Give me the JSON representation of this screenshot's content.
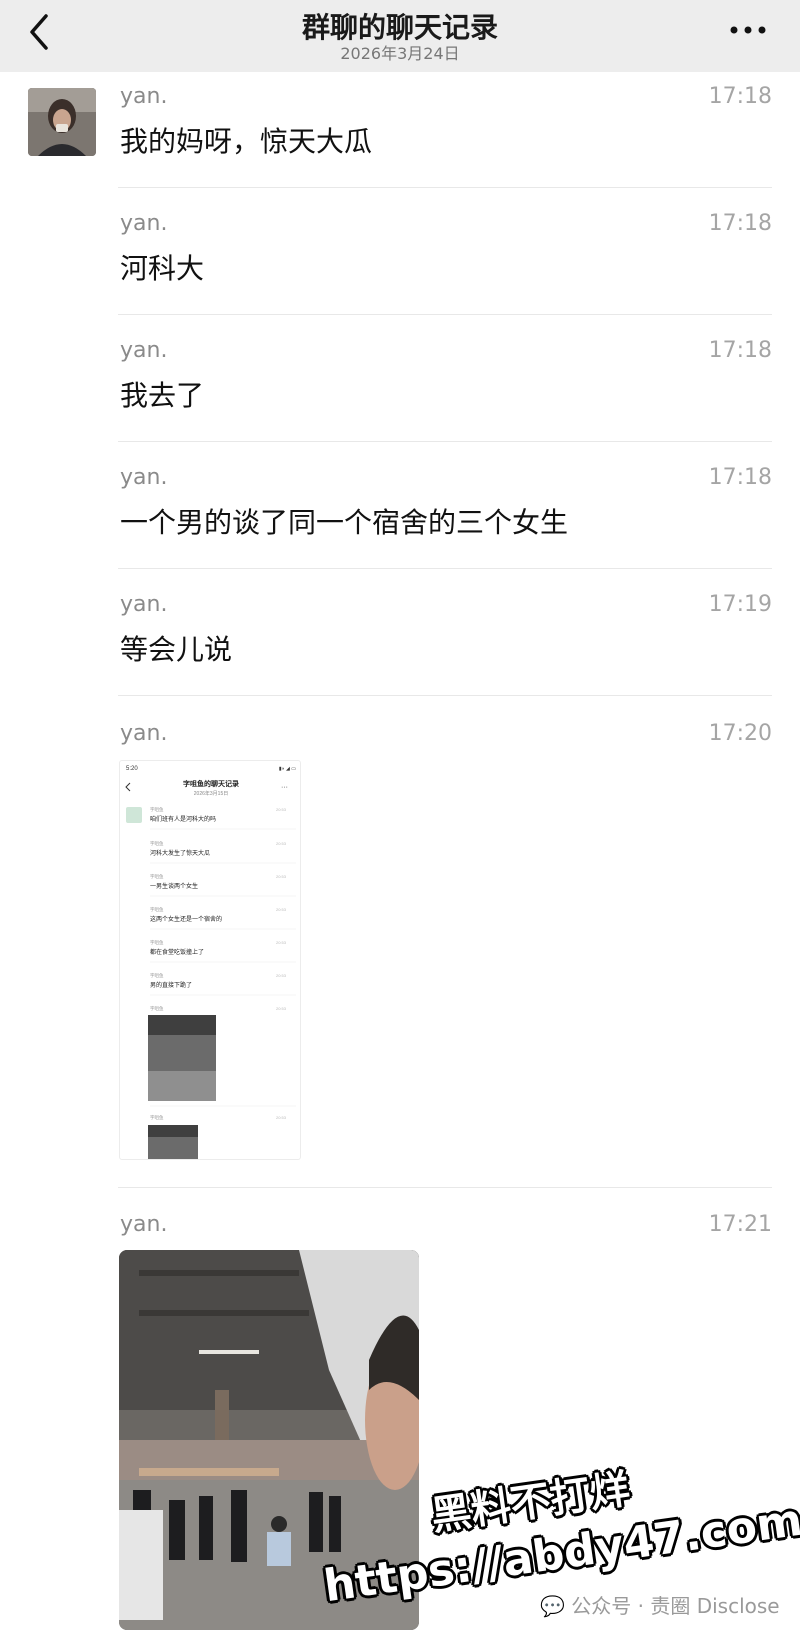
{
  "header": {
    "title": "群聊的聊天记录",
    "subtitle": "2026年3月24日",
    "back_icon": "chevron-left-icon",
    "more_icon": "more-dots-icon"
  },
  "messages": [
    {
      "sender": "yan.",
      "time": "17:18",
      "text": "我的妈呀，惊天大瓜"
    },
    {
      "sender": "yan.",
      "time": "17:18",
      "text": "河科大"
    },
    {
      "sender": "yan.",
      "time": "17:18",
      "text": "我去了"
    },
    {
      "sender": "yan.",
      "time": "17:18",
      "text": "一个男的谈了同一个宿舍的三个女生"
    },
    {
      "sender": "yan.",
      "time": "17:19",
      "text": "等会儿说"
    },
    {
      "sender": "yan.",
      "time": "17:20",
      "type": "image"
    },
    {
      "sender": "yan.",
      "time": "17:21",
      "type": "image"
    }
  ],
  "nested_screenshot": {
    "status_time": "5:20",
    "title": "字咀鱼的聊天记录",
    "date": "2026年3月15日",
    "sender": "字咀鱼",
    "messages": [
      "咱们班有人是河科大的吗",
      "河科大发生了惊天大瓜",
      "一男生谈两个女生",
      "这两个女生还是一个宿舍的",
      "都在食堂吃饭撞上了",
      "男的直接下跪了"
    ]
  },
  "watermark": {
    "brand": "公众号 · 责圈 Disclose",
    "brand_icon": "wechat-icon",
    "big_line1": "黑料不打烊",
    "big_line2": "https://abdy47.com"
  }
}
